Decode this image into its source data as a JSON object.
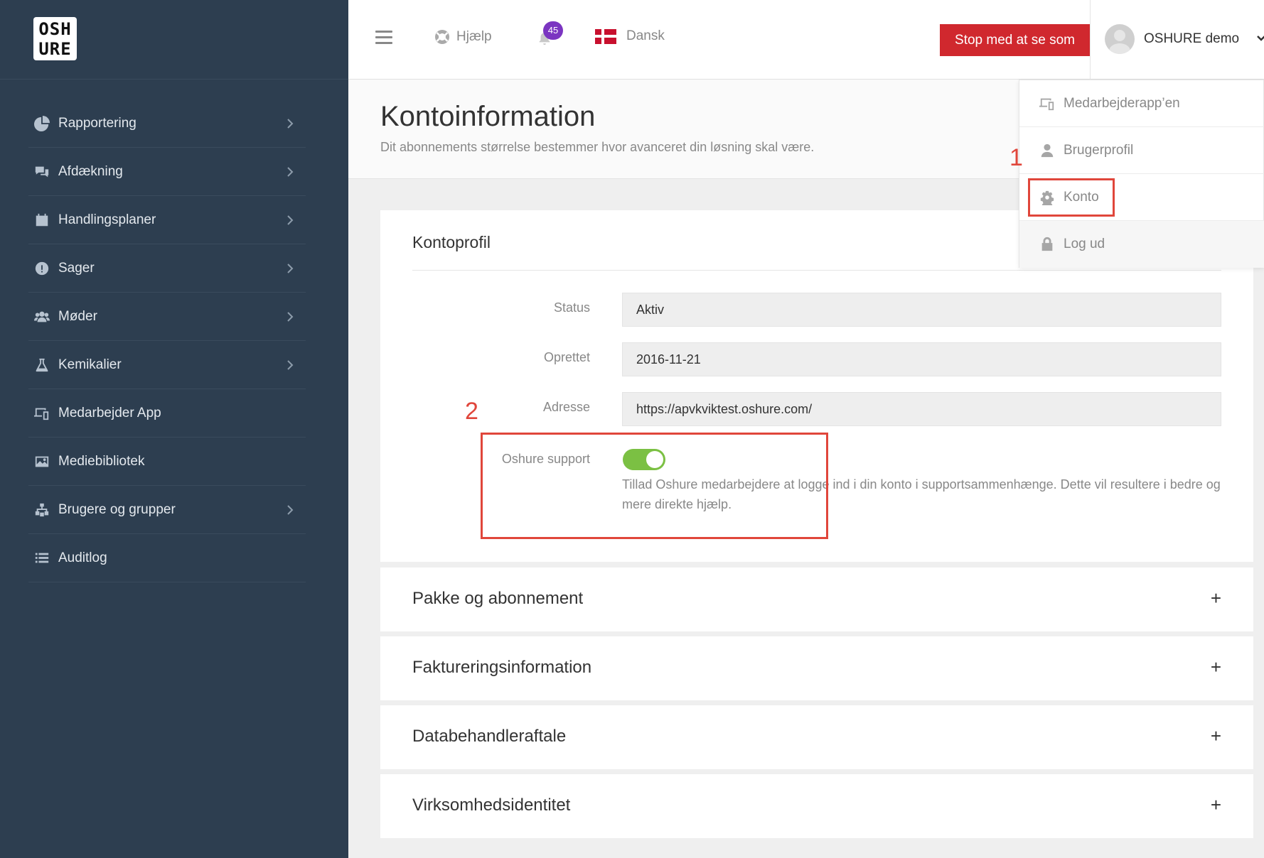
{
  "logo": {
    "line1": "OSH",
    "line2": "URE"
  },
  "sidebar": {
    "items": [
      {
        "label": "Rapportering",
        "icon": "pie-chart-icon",
        "chevron": true
      },
      {
        "label": "Afdækning",
        "icon": "chat-bubbles-icon",
        "chevron": true
      },
      {
        "label": "Handlingsplaner",
        "icon": "calendar-icon",
        "chevron": true
      },
      {
        "label": "Sager",
        "icon": "alert-circle-icon",
        "chevron": true
      },
      {
        "label": "Møder",
        "icon": "users-icon",
        "chevron": true
      },
      {
        "label": "Kemikalier",
        "icon": "flask-icon",
        "chevron": true
      },
      {
        "label": "Medarbejder App",
        "icon": "devices-icon",
        "chevron": false
      },
      {
        "label": "Mediebibliotek",
        "icon": "image-icon",
        "chevron": false
      },
      {
        "label": "Brugere og grupper",
        "icon": "sitemap-icon",
        "chevron": true
      },
      {
        "label": "Auditlog",
        "icon": "list-icon",
        "chevron": false
      }
    ]
  },
  "topbar": {
    "help_label": "Hjælp",
    "notification_count": "45",
    "language_label": "Dansk",
    "stop_button_label": "Stop med at se som",
    "user_name": "OSHURE demo"
  },
  "page": {
    "title": "Kontoinformation",
    "subtitle": "Dit abonnements størrelse bestemmer hvor avanceret din løsning skal være."
  },
  "kontoprofil": {
    "title": "Kontoprofil",
    "fields": [
      {
        "label": "Status",
        "value": "Aktiv"
      },
      {
        "label": "Oprettet",
        "value": "2016-11-21"
      },
      {
        "label": "Adresse",
        "value": "https://apvkviktest.oshure.com/"
      }
    ],
    "support_label": "Oshure support",
    "support_enabled": true,
    "support_description": "Tillad Oshure medarbejdere at logge ind i din konto i supportsammenhænge. Dette vil resultere i bedre og mere direkte hjælp."
  },
  "sections": [
    {
      "title": "Pakke og abonnement",
      "toggle": "+"
    },
    {
      "title": "Faktureringsinformation",
      "toggle": "+"
    },
    {
      "title": "Databehandleraftale",
      "toggle": "+"
    },
    {
      "title": "Virksomhedsidentitet",
      "toggle": "+"
    }
  ],
  "user_menu": {
    "items": [
      {
        "label": "Medarbejderapp’en",
        "icon": "devices-icon"
      },
      {
        "label": "Brugerprofil",
        "icon": "user-icon"
      },
      {
        "label": "Konto",
        "icon": "gear-icon"
      },
      {
        "label": "Log ud",
        "icon": "lock-icon"
      }
    ]
  },
  "annotations": {
    "one": "1",
    "two": "2",
    "color": "#e0463b"
  },
  "colors": {
    "sidebar": "#2d3e50",
    "stop_button": "#d0282e",
    "toggle_on": "#7bc043",
    "badge": "#7b35c1"
  }
}
